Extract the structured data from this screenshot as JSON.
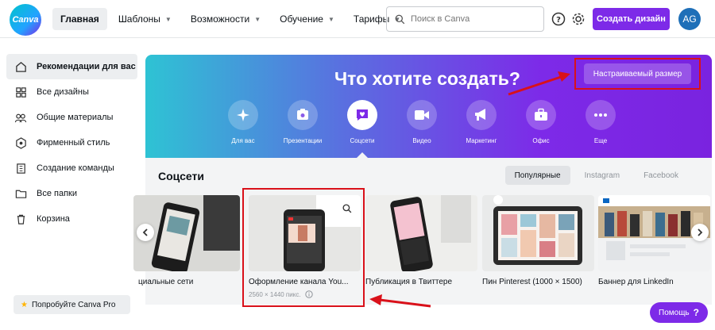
{
  "logo": {
    "text": "Canva"
  },
  "nav": [
    {
      "label": "Главная"
    },
    {
      "label": "Шаблоны"
    },
    {
      "label": "Возможности"
    },
    {
      "label": "Обучение"
    },
    {
      "label": "Тарифы"
    }
  ],
  "search": {
    "placeholder": "Поиск в Canva"
  },
  "header": {
    "create_label": "Создать дизайн",
    "avatar_initials": "AG"
  },
  "sidebar": {
    "items": [
      {
        "label": "Рекомендации для вас",
        "icon": "home-icon"
      },
      {
        "label": "Все дизайны",
        "icon": "grid-icon"
      },
      {
        "label": "Общие материалы",
        "icon": "people-icon"
      },
      {
        "label": "Фирменный стиль",
        "icon": "brand-icon"
      },
      {
        "label": "Создание команды",
        "icon": "building-icon"
      },
      {
        "label": "Все папки",
        "icon": "folder-icon"
      },
      {
        "label": "Корзина",
        "icon": "trash-icon"
      }
    ],
    "try_pro": "Попробуйте Canva Pro"
  },
  "hero": {
    "title": "Что хотите создать?",
    "custom_size": "Настраиваемый размер",
    "categories": [
      {
        "label": "Для вас",
        "icon": "sparkle-icon"
      },
      {
        "label": "Презентации",
        "icon": "presentation-icon"
      },
      {
        "label": "Соцсети",
        "icon": "heart-chat-icon"
      },
      {
        "label": "Видео",
        "icon": "video-icon"
      },
      {
        "label": "Маркетинг",
        "icon": "megaphone-icon"
      },
      {
        "label": "Офис",
        "icon": "briefcase-icon"
      },
      {
        "label": "Еще",
        "icon": "more-icon"
      }
    ]
  },
  "section": {
    "title": "Соцсети",
    "chips": [
      "Популярные",
      "Instagram",
      "Facebook"
    ],
    "cards": [
      {
        "title": "циальные сети",
        "sub": ""
      },
      {
        "title": "Оформление канала You...",
        "sub": "2560 × 1440 пикс."
      },
      {
        "title": "Публикация в Твиттере",
        "sub": ""
      },
      {
        "title": "Пин Pinterest (1000 × 1500)",
        "sub": ""
      },
      {
        "title": "Баннер для LinkedIn",
        "sub": ""
      }
    ]
  },
  "help": {
    "label": "Помощь",
    "mark": "?"
  },
  "colors": {
    "brand": "#7d2ae8",
    "annotation": "#d9111a"
  }
}
